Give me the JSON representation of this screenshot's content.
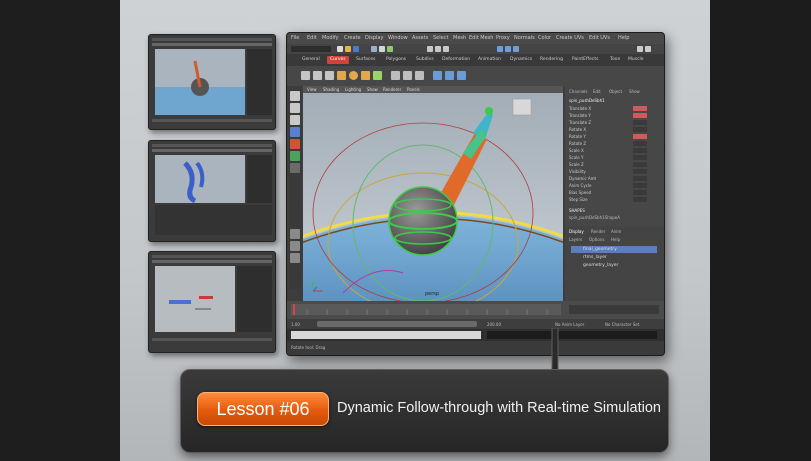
{
  "lesson": {
    "badge": "Lesson #06",
    "title": "Dynamic Follow-through with Real-time Simulation"
  },
  "maya": {
    "menu": [
      "File",
      "Edit",
      "Modify",
      "Create",
      "Display",
      "Window",
      "Assets",
      "Select",
      "Mesh",
      "Edit Mesh",
      "Proxy",
      "Normals",
      "Color",
      "Create UVs",
      "Edit UVs",
      "Help"
    ],
    "shelf_tabs": [
      "General",
      "Curves",
      "Surfaces",
      "Polygons",
      "Subdivs",
      "Deformation",
      "Animation",
      "Dynamics",
      "Rendering",
      "PaintEffects",
      "Toon",
      "Muscle"
    ],
    "viewport_menu": [
      "View",
      "Shading",
      "Lighting",
      "Show",
      "Renderer",
      "Panels"
    ],
    "camera_label": "persp",
    "channel_box": {
      "tabs": [
        "Channels",
        "Edit",
        "Object",
        "Show"
      ],
      "object": "spin_pushDeSbh1",
      "attributes": [
        "Translate X",
        "Translate Y",
        "Translate Z",
        "Rotate X",
        "Rotate Y",
        "Rotate Z",
        "Scale X",
        "Scale Y",
        "Scale Z",
        "Visibility",
        "Dynamic Amt",
        "Anim Cycle",
        "Bias Speed",
        "Step Size"
      ],
      "shapes_label": "SHAPES",
      "shape_name": "spin_pushDeSbh1ShapeA"
    },
    "layers": {
      "tabs": [
        "Display",
        "Render",
        "Anim"
      ],
      "menu": [
        "Layers",
        "Options",
        "Help"
      ],
      "items": [
        "final_geometry",
        "rtms_layer",
        "geometry_layer"
      ]
    },
    "timeline": {
      "start": "1.00",
      "end": "200.00",
      "current": "1.00",
      "anim_layer": "No Anim Layer",
      "char_set": "No Character Set"
    },
    "help_line": "Rotate tool: Drag"
  },
  "colors": {
    "accent": "#e8641a",
    "maya_red": "#d0423a",
    "sphere_green": "#3ec94a"
  }
}
